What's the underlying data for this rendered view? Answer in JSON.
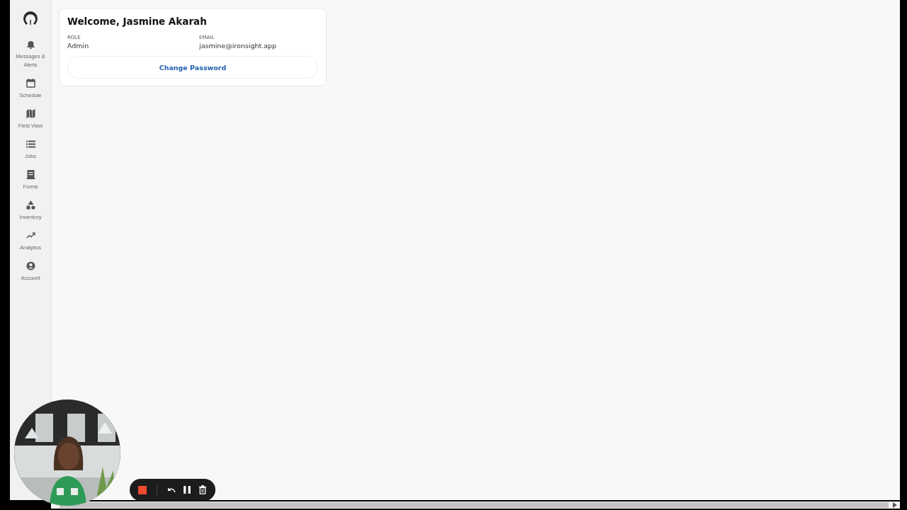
{
  "sidebar": {
    "items": [
      {
        "label": "Messages & Alerts"
      },
      {
        "label": "Schedule"
      },
      {
        "label": "Field View"
      },
      {
        "label": "Jobs"
      },
      {
        "label": "Forms"
      },
      {
        "label": "Inventory"
      },
      {
        "label": "Analytics"
      },
      {
        "label": "Account"
      }
    ]
  },
  "profile_card": {
    "title": "Welcome, Jasmine Akarah",
    "fields": [
      {
        "label": "ROLE",
        "value": "Admin"
      },
      {
        "label": "EMAIL",
        "value": "jasmine@ironsight.app"
      }
    ],
    "button": "Change Password"
  },
  "recording_controls": {
    "recording": true
  }
}
